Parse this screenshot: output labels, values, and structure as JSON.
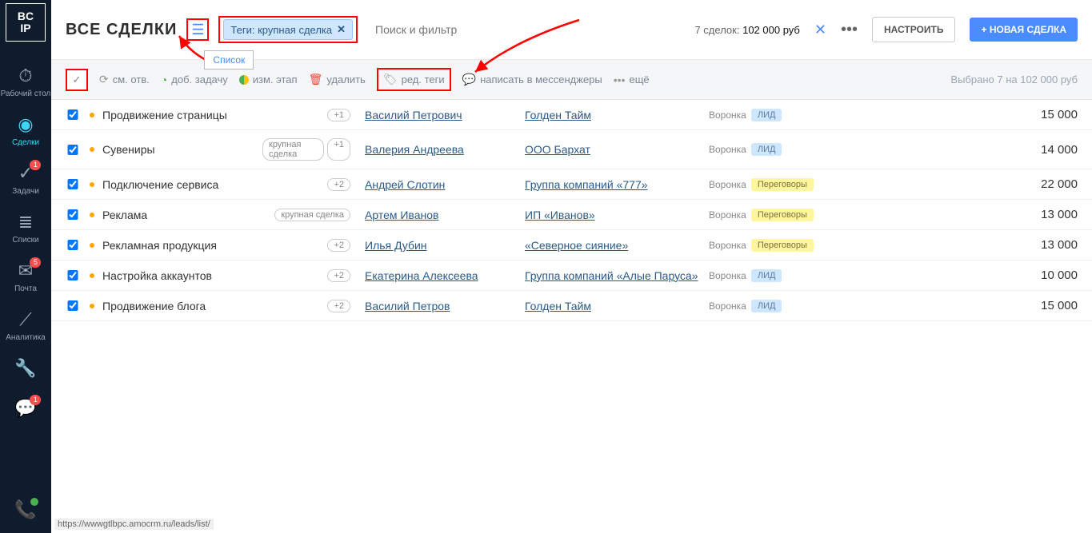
{
  "logo": {
    "top": "BC",
    "bottom": "IP"
  },
  "sidebar": [
    {
      "icon": "⏱",
      "label": "Рабочий стол",
      "badge": ""
    },
    {
      "icon": "◉",
      "label": "Сделки",
      "badge": "",
      "active": true
    },
    {
      "icon": "✓",
      "label": "Задачи",
      "badge": "1"
    },
    {
      "icon": "≣",
      "label": "Списки",
      "badge": ""
    },
    {
      "icon": "✉",
      "label": "Почта",
      "badge": "5"
    },
    {
      "icon": "⟋",
      "label": "Аналитика",
      "badge": ""
    },
    {
      "icon": "🔧",
      "label": "",
      "badge": ""
    },
    {
      "icon": "💬",
      "label": "",
      "badge": "1"
    }
  ],
  "header": {
    "title": "ВСЕ СДЕЛКИ",
    "tooltip": "Список",
    "tag_chip": "Теги: крупная сделка",
    "search_placeholder": "Поиск и фильтр",
    "summary_prefix": "7 сделок:",
    "summary_amount": "102 000 руб",
    "configure": "НАСТРОИТЬ",
    "new_deal": "+ НОВАЯ СДЕЛКА"
  },
  "actions": {
    "change_owner": "см. отв.",
    "add_task": "доб. задачу",
    "change_stage": "изм. этап",
    "delete": "удалить",
    "edit_tags": "ред. теги",
    "messengers": "написать в мессенджеры",
    "more": "ещё",
    "selected": "Выбрано 7 на 102 000 руб"
  },
  "funnel_label": "Воронка",
  "stage_lid": "ЛИД",
  "stage_neg": "Переговоры",
  "deals": [
    {
      "name": "Продвижение страницы",
      "tags": [
        "+1"
      ],
      "manager": "Василий Петрович",
      "company": "Голден Тайм",
      "stage": "lid",
      "amount": "15 000"
    },
    {
      "name": "Сувениры",
      "tags": [
        "крупная сделка",
        "+1"
      ],
      "manager": "Валерия Андреева",
      "company": "ООО Бархат",
      "stage": "lid",
      "amount": "14 000"
    },
    {
      "name": "Подключение сервиса",
      "tags": [
        "+2"
      ],
      "manager": "Андрей Слотин",
      "company": "Группа компаний «777»",
      "stage": "neg",
      "amount": "22 000"
    },
    {
      "name": "Реклама",
      "tags": [
        "крупная сделка"
      ],
      "manager": "Артем Иванов",
      "company": "ИП «Иванов»",
      "stage": "neg",
      "amount": "13 000"
    },
    {
      "name": "Рекламная продукция",
      "tags": [
        "+2"
      ],
      "manager": "Илья Дубин",
      "company": "«Северное сияние»",
      "stage": "neg",
      "amount": "13 000"
    },
    {
      "name": "Настройка аккаунтов",
      "tags": [
        "+2"
      ],
      "manager": "Екатерина Алексеева",
      "company": "Группа компаний «Алые Паруса»",
      "stage": "lid",
      "amount": "10 000"
    },
    {
      "name": "Продвижение блога",
      "tags": [
        "+2"
      ],
      "manager": "Василий Петров",
      "company": "Голден Тайм",
      "stage": "lid",
      "amount": "15 000"
    }
  ],
  "footer_url": "https://wwwgtlbpc.amocrm.ru/leads/list/"
}
